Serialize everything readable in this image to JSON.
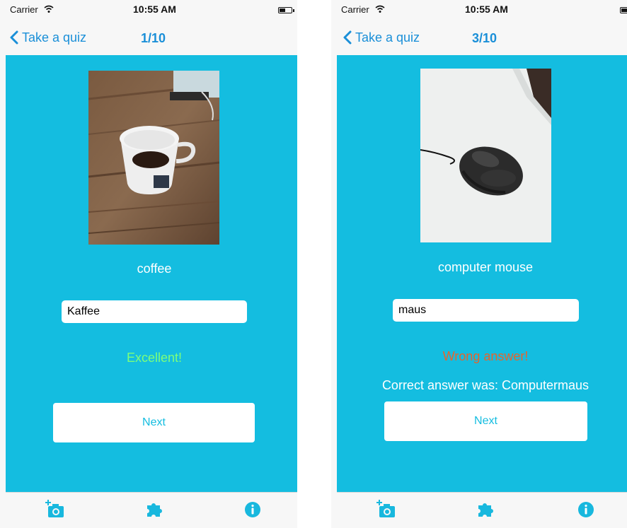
{
  "screens": [
    {
      "status": {
        "carrier": "Carrier",
        "time": "10:55 AM"
      },
      "nav": {
        "back_label": "Take a quiz",
        "progress": "1/10"
      },
      "quiz": {
        "word": "coffee",
        "answer": "Kaffee",
        "feedback": "Excellent!",
        "feedback_color": "#7dff7a",
        "correct_line": "",
        "next_label": "Next"
      },
      "tabs": [
        "camera-add-icon",
        "puzzle-icon",
        "info-icon"
      ]
    },
    {
      "status": {
        "carrier": "Carrier",
        "time": "10:55 AM"
      },
      "nav": {
        "back_label": "Take a quiz",
        "progress": "3/10"
      },
      "quiz": {
        "word": "computer mouse",
        "answer": "maus",
        "feedback": "Wrong answer!",
        "feedback_color": "#e8632a",
        "correct_line": "Correct answer was: Computermaus",
        "next_label": "Next"
      },
      "tabs": [
        "camera-add-icon",
        "puzzle-icon",
        "info-icon"
      ]
    }
  ],
  "colors": {
    "accent": "#1a8fd8",
    "content_bg": "#14bde0",
    "tab_icon": "#18b8de"
  }
}
